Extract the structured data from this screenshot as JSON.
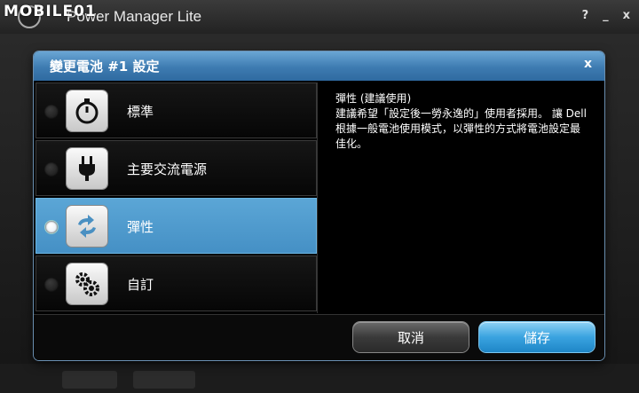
{
  "watermark": "MOBILE01",
  "app": {
    "title": "Power Manager Lite",
    "controls": {
      "help": "?",
      "minimize": "_",
      "close": "x"
    }
  },
  "dialog": {
    "title": "變更電池 #1 設定",
    "close": "x",
    "plans": [
      {
        "label": "標準",
        "icon": "stopwatch-icon",
        "selected": false
      },
      {
        "label": "主要交流電源",
        "icon": "ac-plug-icon",
        "selected": false
      },
      {
        "label": "彈性",
        "icon": "cycle-arrows-icon",
        "selected": true
      },
      {
        "label": "自訂",
        "icon": "gears-icon",
        "selected": false
      }
    ],
    "description": {
      "heading": "彈性 (建議使用)",
      "body": "建議希望「設定後一勞永逸的」使用者採用。 讓 Dell 根據一般電池使用模式，以彈性的方式將電池設定最佳化。"
    },
    "buttons": {
      "cancel": "取消",
      "save": "儲存"
    }
  },
  "colors": {
    "accent": "#4590c5",
    "header": "#3d7bb1",
    "save_button": "#3aa3e0"
  }
}
